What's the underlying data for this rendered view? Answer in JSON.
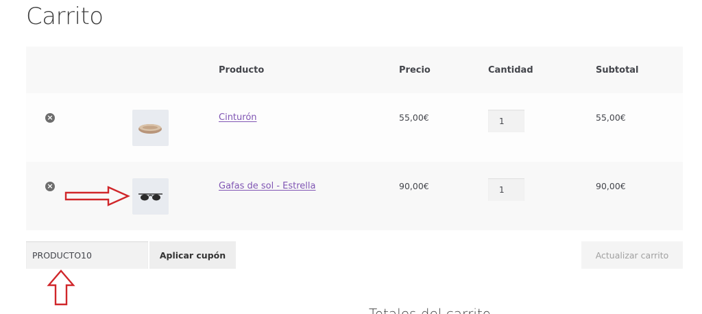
{
  "page": {
    "title": "Carrito"
  },
  "table": {
    "headers": {
      "product": "Producto",
      "price": "Precio",
      "quantity": "Cantidad",
      "subtotal": "Subtotal"
    },
    "rows": [
      {
        "remove": "×",
        "thumbnail": "belt-thumbnail",
        "product": "Cinturón",
        "price": "55,00€",
        "quantity": "1",
        "subtotal": "55,00€"
      },
      {
        "remove": "×",
        "thumbnail": "sunglasses-thumbnail",
        "product": "Gafas de sol - Estrella",
        "price": "90,00€",
        "quantity": "1",
        "subtotal": "90,00€"
      }
    ]
  },
  "actions": {
    "coupon_value": "PRODUCTO10",
    "apply_coupon": "Aplicar cupón",
    "update_cart": "Actualizar carrito"
  },
  "totals": {
    "title": "Totales del carrito"
  },
  "colors": {
    "link": "#7f54b3",
    "annotation_arrow": "#d0262a"
  }
}
